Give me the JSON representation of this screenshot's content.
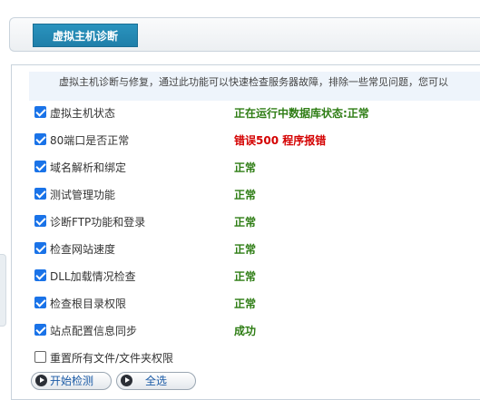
{
  "header": {
    "tab_label": "虚拟主机诊断"
  },
  "description": "虚拟主机诊断与修复，通过此功能可以快速检查服务器故障，排除一些常见问题，您可以",
  "colors": {
    "ok": "#2e7d14",
    "error": "#d40000",
    "tab": "#1f7fa9"
  },
  "items": [
    {
      "label": "虚拟主机状态",
      "checked": true,
      "status": "正在运行中数据库状态:正常",
      "state": "ok"
    },
    {
      "label": "80端口是否正常",
      "checked": true,
      "status": "错误500 程序报错",
      "state": "error"
    },
    {
      "label": "域名解析和绑定",
      "checked": true,
      "status": "正常",
      "state": "ok"
    },
    {
      "label": "测试管理功能",
      "checked": true,
      "status": "正常",
      "state": "ok"
    },
    {
      "label": "诊断FTP功能和登录",
      "checked": true,
      "status": "正常",
      "state": "ok"
    },
    {
      "label": "检查网站速度",
      "checked": true,
      "status": "正常",
      "state": "ok"
    },
    {
      "label": "DLL加载情况检查",
      "checked": true,
      "status": "正常",
      "state": "ok"
    },
    {
      "label": "检查根目录权限",
      "checked": true,
      "status": "正常",
      "state": "ok"
    },
    {
      "label": "站点配置信息同步",
      "checked": true,
      "status": "成功",
      "state": "ok"
    },
    {
      "label": "重置所有文件/文件夹权限",
      "checked": false,
      "status": "",
      "state": "none"
    }
  ],
  "buttons": {
    "start": "开始检测",
    "select_all": "全选"
  }
}
